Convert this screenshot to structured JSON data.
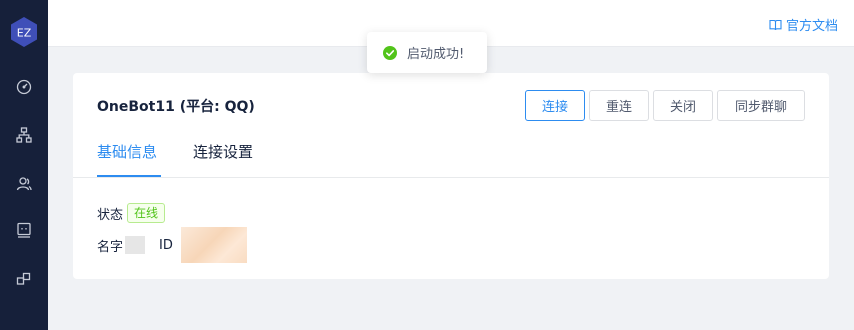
{
  "sidebar": {
    "logo_text": "EZ",
    "items": [
      {
        "icon": "dashboard-icon"
      },
      {
        "icon": "sitemap-icon"
      },
      {
        "icon": "users-icon"
      },
      {
        "icon": "robot-icon"
      },
      {
        "icon": "plugins-icon"
      }
    ]
  },
  "header": {
    "docs_icon": "book-icon",
    "docs_label": "官方文档"
  },
  "toast": {
    "icon": "check-circle-icon",
    "message": "启动成功!"
  },
  "bot": {
    "title": "OneBot11 (平台: QQ)",
    "actions": {
      "connect": "连接",
      "reconnect": "重连",
      "close": "关闭",
      "sync_groups": "同步群聊"
    },
    "tabs": [
      {
        "label": "基础信息",
        "active": true
      },
      {
        "label": "连接设置",
        "active": false
      }
    ],
    "info": {
      "status_label": "状态",
      "status_value": "在线",
      "name_label": "名字",
      "id_label": "ID"
    }
  },
  "colors": {
    "accent": "#2d8cf0",
    "sidebar_bg": "#16203a",
    "success": "#52c41a"
  }
}
